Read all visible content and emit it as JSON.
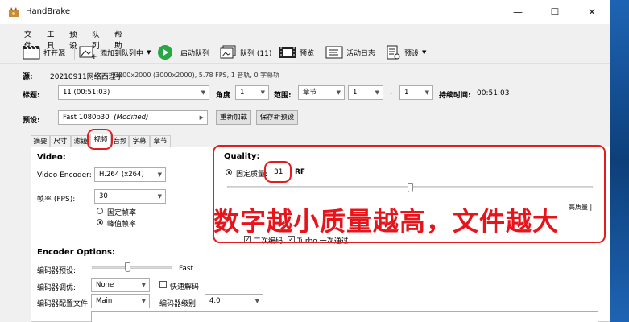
{
  "window": {
    "title": "HandBrake",
    "minimize": "—",
    "maximize": "☐",
    "close": "✕"
  },
  "menu": [
    "文件",
    "工具",
    "预设",
    "队列",
    "帮助"
  ],
  "toolbar": {
    "open_source": "打开源",
    "add_queue": "添加到队列中",
    "start_queue": "启动队列",
    "queue": "队列 (11)",
    "preview": "预览",
    "activity_log": "活动日志",
    "presets": "预设"
  },
  "source": {
    "label": "源:",
    "name": "20210911网络西理学",
    "info": "3000x2000 (3000x2000), 5.78 FPS, 1 音轨, 0 字幕轨"
  },
  "title_row": {
    "title_label": "标题:",
    "title_value": "11 (00:51:03)",
    "angle_label": "角度",
    "angle_value": "1",
    "range_label": "范围:",
    "range_value": "章节",
    "from_value": "1",
    "dash": "-",
    "to_value": "1",
    "duration_label": "持续时间:",
    "duration_value": "00:51:03"
  },
  "preset_row": {
    "label": "预设:",
    "value": "Fast 1080p30",
    "modified": "(Modified)",
    "reload": "重新加载",
    "save_new": "保存新预设"
  },
  "tabs": [
    "摘要",
    "尺寸",
    "滤镜",
    "视频",
    "音频",
    "字幕",
    "章节"
  ],
  "video": {
    "heading": "Video:",
    "encoder_label": "Video Encoder:",
    "encoder_value": "H.264 (x264)",
    "fps_label": "帧率 (FPS):",
    "fps_value": "30",
    "const_fps": "固定帧率",
    "peak_fps": "峰值帧率"
  },
  "quality": {
    "heading": "Quality:",
    "const_quality": "固定质量:",
    "rf_value": "31",
    "rf_unit": "RF",
    "high_quality": "高质量 |",
    "two_pass": "二次编码",
    "turbo": "Turbo 一次通过",
    "slider_level": 0.5
  },
  "encoder_options": {
    "heading": "Encoder Options:",
    "preset_label": "编码器预设:",
    "preset_speed": "Fast",
    "tune_label": "编码器调优:",
    "tune_value": "None",
    "fast_decode": "快速解码",
    "profile_label": "编码器配置文件:",
    "profile_value": "Main",
    "level_label": "编码器级别:",
    "level_value": "4.0"
  },
  "annotation": {
    "text": "数字越小质量越高，文件越大"
  },
  "colors": {
    "annotation": "#e8141c",
    "accent": "#1976d2"
  }
}
